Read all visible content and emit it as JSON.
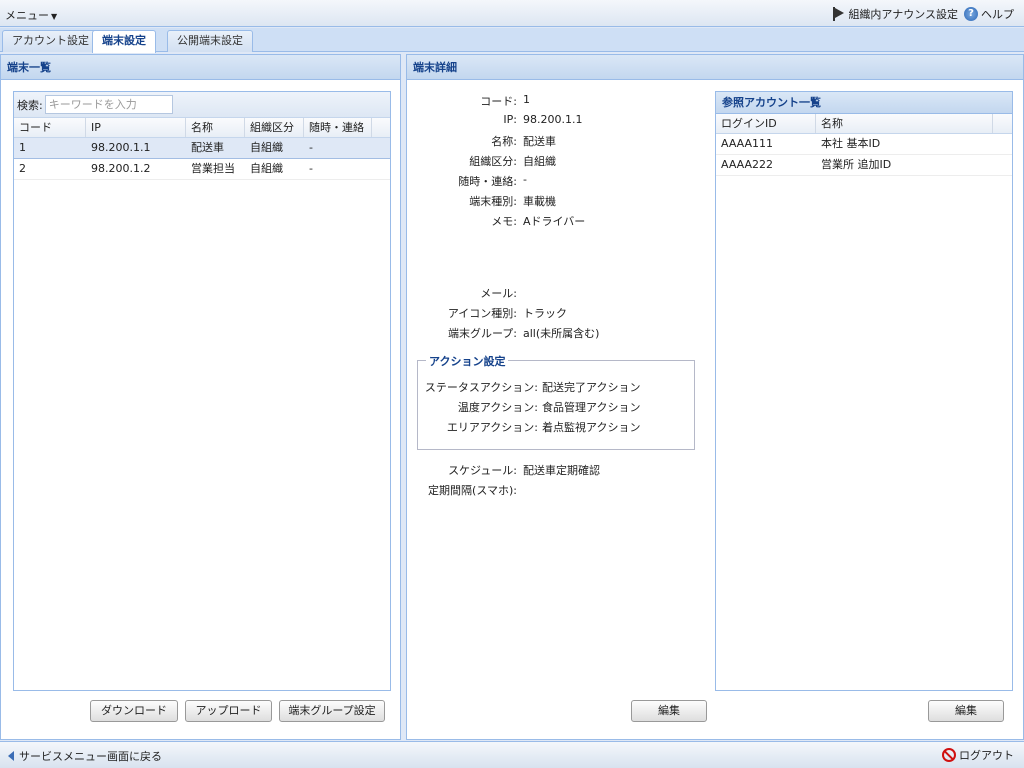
{
  "topbar": {
    "menu_label": "メニュー",
    "announce_label": "組織内アナウンス設定",
    "help_label": "ヘルプ"
  },
  "tabs": [
    {
      "label": "アカウント設定",
      "active": false
    },
    {
      "label": "端末設定",
      "active": true
    },
    {
      "label": "公開端末設定",
      "active": false
    }
  ],
  "terminal_list": {
    "title": "端末一覧",
    "search_label": "検索:",
    "search_placeholder": "キーワードを入力",
    "search_value": "",
    "columns": [
      "コード",
      "IP",
      "名称",
      "組織区分",
      "随時・連絡"
    ],
    "rows": [
      {
        "code": "1",
        "ip": "98.200.1.1",
        "name": "配送車",
        "org": "自組織",
        "contact": "-",
        "selected": true
      },
      {
        "code": "2",
        "ip": "98.200.1.2",
        "name": "営業担当",
        "org": "自組織",
        "contact": "-",
        "selected": false
      }
    ],
    "buttons": {
      "download": "ダウンロード",
      "upload": "アップロード",
      "group": "端末グループ設定"
    }
  },
  "terminal_detail": {
    "title": "端末詳細",
    "fields": [
      {
        "label": "コード:",
        "value": "1"
      },
      {
        "label": "IP:",
        "value": "98.200.1.1"
      },
      {
        "label": "名称:",
        "value": "配送車"
      },
      {
        "label": "組織区分:",
        "value": "自組織"
      },
      {
        "label": "随時・連絡:",
        "value": "-"
      },
      {
        "label": "端末種別:",
        "value": "車載機"
      },
      {
        "label": "メモ:",
        "value": "Aドライバー"
      }
    ],
    "fields2": [
      {
        "label": "メール:",
        "value": ""
      },
      {
        "label": "アイコン種別:",
        "value": "トラック"
      },
      {
        "label": "端末グループ:",
        "value": "all(未所属含む)"
      }
    ],
    "action_settings": {
      "legend": "アクション設定",
      "rows": [
        {
          "label": "ステータスアクション:",
          "value": "配送完了アクション"
        },
        {
          "label": "温度アクション:",
          "value": "食品管理アクション"
        },
        {
          "label": "エリアアクション:",
          "value": "着点監視アクション"
        }
      ]
    },
    "fields3": [
      {
        "label": "スケジュール:",
        "value": "配送車定期確認"
      },
      {
        "label": "定期間隔(スマホ):",
        "value": ""
      }
    ],
    "edit_label": "編集"
  },
  "account_list": {
    "title": "参照アカウント一覧",
    "columns": [
      "ログインID",
      "名称"
    ],
    "rows": [
      {
        "login_id": "AAAA111",
        "name": "本社 基本ID"
      },
      {
        "login_id": "AAAA222",
        "name": "営業所 追加ID"
      }
    ],
    "edit_label": "編集"
  },
  "statusbar": {
    "back_label": "サービスメニュー画面に戻る",
    "logout_label": "ログアウト"
  }
}
